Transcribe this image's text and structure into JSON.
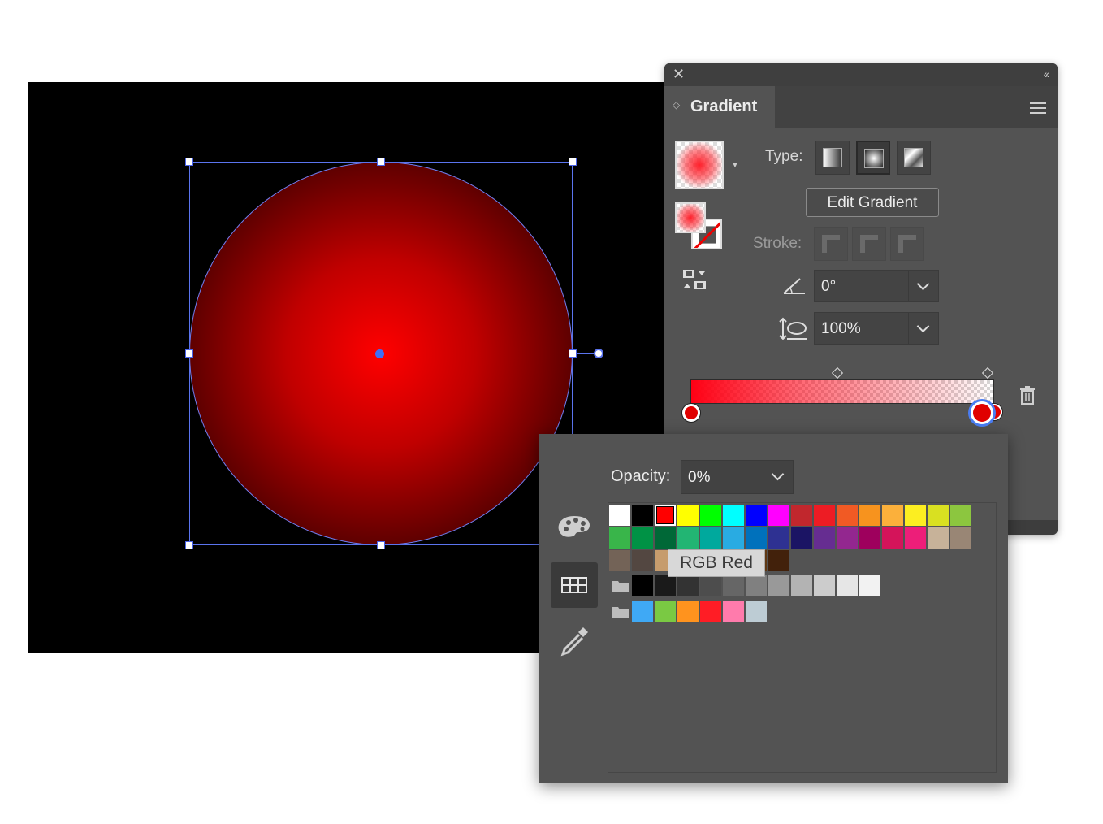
{
  "panel": {
    "title": "Gradient",
    "type_label": "Type:",
    "edit_gradient": "Edit Gradient",
    "stroke_label": "Stroke:",
    "angle_value": "0°",
    "aspect_value": "100%",
    "type_selected": "radial"
  },
  "popup": {
    "opacity_label": "Opacity:",
    "opacity_value": "0%",
    "tooltip": "RGB Red",
    "row1": [
      "#ffffff",
      "#000000",
      "#ff0000",
      "#ffff00",
      "#00ff00",
      "#00ffff",
      "#0000ff",
      "#ff00ff",
      "#c1272d",
      "#ed1c24",
      "#f15a24",
      "#f7931e",
      "#fbb03b",
      "#fcee21",
      "#d9e021",
      "#8cc63f"
    ],
    "row2": [
      "#39b54a",
      "#009245",
      "#006837",
      "#22b573",
      "#00a99d",
      "#29abe2",
      "#0071bc",
      "#2e3192",
      "#1b1464",
      "#662d91",
      "#93278f",
      "#9e005d",
      "#d4145a",
      "#ed1e79",
      "#c7b299",
      "#998675"
    ],
    "row3": [
      "#736357",
      "#534741",
      "#c69c6d",
      "#a67c52",
      "#8c6239",
      "#754c24",
      "#603813",
      "#42210b"
    ],
    "row4": [
      "#000000",
      "#1a1a1a",
      "#333333",
      "#4d4d4d",
      "#666666",
      "#808080",
      "#999999",
      "#b3b3b3",
      "#cccccc",
      "#e6e6e6",
      "#f2f2f2"
    ],
    "row5": [
      "#3fa9f5",
      "#7ac943",
      "#ff931e",
      "#ff1d25",
      "#ff7bac",
      "#bdccd4"
    ]
  },
  "colors": {
    "accent": "#4a63e8",
    "panel_bg": "#535353"
  }
}
